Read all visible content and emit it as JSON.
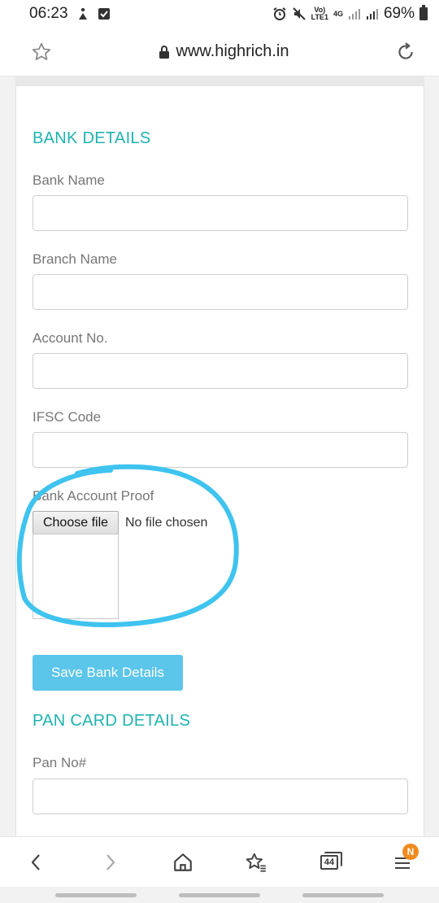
{
  "status_bar": {
    "time": "06:23",
    "network_top": "Vo)",
    "network_bottom": "LTE1",
    "network_type": "4G",
    "battery": "69%"
  },
  "address_bar": {
    "url": "www.highrich.in"
  },
  "bank_section": {
    "title": "BANK DETAILS",
    "fields": [
      {
        "label": "Bank Name",
        "value": ""
      },
      {
        "label": "Branch Name",
        "value": ""
      },
      {
        "label": "Account No.",
        "value": ""
      },
      {
        "label": "IFSC Code",
        "value": ""
      }
    ],
    "proof_label": "Bank Account Proof",
    "file_button": "Choose file",
    "file_status": "No file chosen",
    "save_button": "Save Bank Details"
  },
  "pan_section": {
    "title": "PAN CARD DETAILS",
    "fields": [
      {
        "label": "Pan No#",
        "value": ""
      }
    ]
  },
  "bottom_nav": {
    "tab_count": "44",
    "badge": "N"
  },
  "colors": {
    "section_title": "#1fb3b0",
    "save_button": "#5bc5ea",
    "annotation": "#3fc3ef",
    "badge": "#f08c1f"
  },
  "icons": [
    "star-icon",
    "lock-icon",
    "reload-icon",
    "back-icon",
    "forward-icon",
    "home-icon",
    "bookmarks-icon",
    "tabs-icon",
    "menu-icon"
  ]
}
